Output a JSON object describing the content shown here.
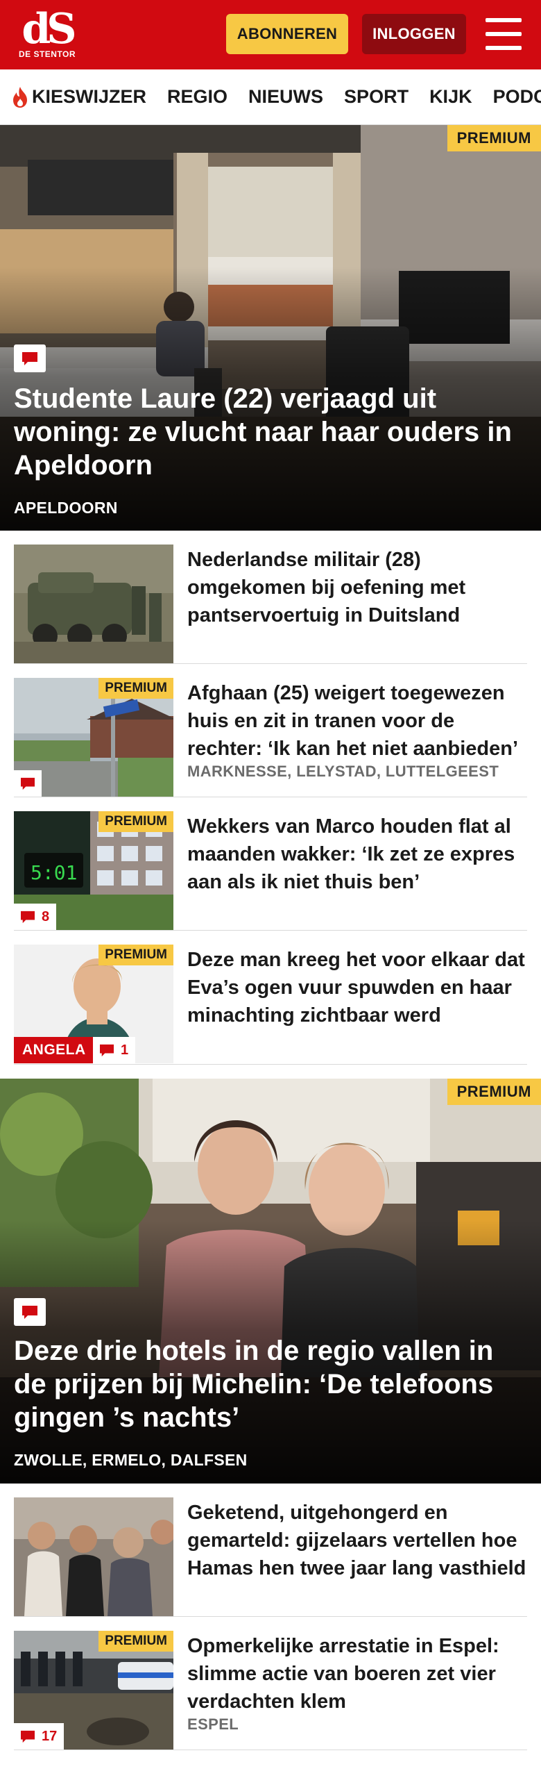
{
  "header": {
    "logo_mark": "dS",
    "logo_sub": "DE STENTOR",
    "subscribe_label": "ABONNEREN",
    "login_label": "INLOGGEN",
    "menu_icon": "hamburger-menu-icon",
    "brand_color": "#d10a11",
    "accent_color": "#f7c844"
  },
  "nav": {
    "items": [
      {
        "label": "KIESWIJZER",
        "icon": "flame-icon"
      },
      {
        "label": "REGIO"
      },
      {
        "label": "NIEUWS"
      },
      {
        "label": "SPORT"
      },
      {
        "label": "KIJK"
      },
      {
        "label": "PODCASTS"
      }
    ]
  },
  "hero1": {
    "premium": "PREMIUM",
    "title": "Studente Laure (22) verjaagd uit woning: ze vlucht naar haar ouders in Apeldoorn",
    "location": "APELDOORN",
    "comment_icon": "comment-icon"
  },
  "list1": [
    {
      "title": "Nederlandse militair (28) omgekomen bij oefening met pantservoertuig in Duitsland"
    },
    {
      "premium": "PREMIUM",
      "title": "Afghaan (25) weigert toegewezen huis en zit in tranen voor de rechter: ‘Ik kan het niet aanbieden’",
      "location": "MARKNESSE, LELYSTAD, LUTTELGEEST"
    },
    {
      "premium": "PREMIUM",
      "comments": "8",
      "clock": "5:01",
      "title": "Wekkers van Marco houden flat al maanden wakker: ‘Ik zet ze expres aan als ik niet thuis ben’"
    },
    {
      "premium": "PREMIUM",
      "author": "ANGELA",
      "comments": "1",
      "title": "Deze man kreeg het voor elkaar dat Eva’s ogen vuur spuwden en haar minachting zichtbaar werd"
    }
  ],
  "hero2": {
    "premium": "PREMIUM",
    "title": "Deze drie hotels in de regio vallen in de prijzen bij Michelin: ‘De telefoons gingen ’s nachts’",
    "location": "ZWOLLE, ERMELO, DALFSEN",
    "comment_icon": "comment-icon"
  },
  "list2": [
    {
      "title": "Geketend, uitgehongerd en gemarteld: gijzelaars vertellen hoe Hamas hen twee jaar lang vasthield"
    },
    {
      "premium": "PREMIUM",
      "comments": "17",
      "title": "Opmerkelijke arrestatie in Espel: slimme actie van boeren zet vier verdachten klem",
      "location": "ESPEL"
    }
  ]
}
